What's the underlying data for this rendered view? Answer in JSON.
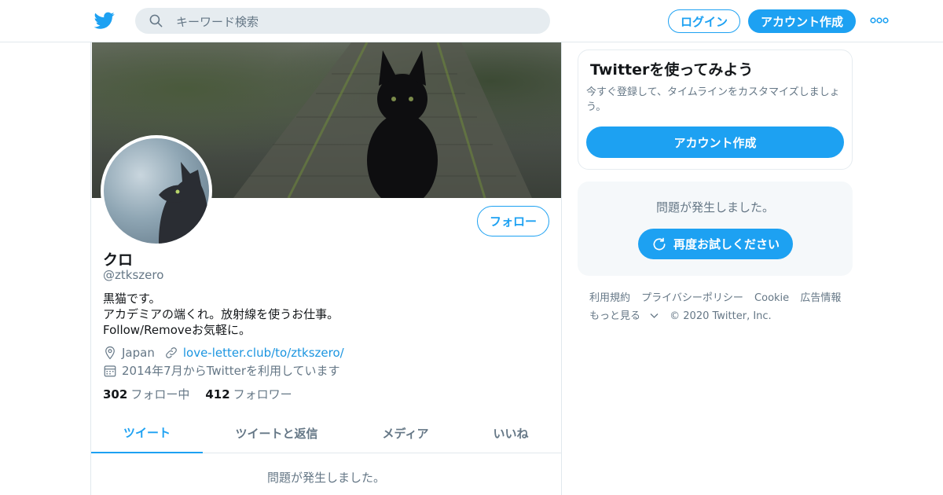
{
  "header": {
    "search_placeholder": "キーワード検索",
    "login_label": "ログイン",
    "signup_label": "アカウント作成",
    "more_icon": "ellipsis-icon",
    "brand_color": "#1da1f2"
  },
  "profile": {
    "name": "クロ",
    "handle": "@ztkszero",
    "follow_label": "フォロー",
    "bio": [
      "黒猫です。",
      "アカデミアの端くれ。放射線を使うお仕事。",
      "Follow/Removeお気軽に。"
    ],
    "location": "Japan",
    "website": "love-letter.club/to/ztkszero/",
    "joined": "2014年7月からTwitterを利用しています",
    "following_count": "302",
    "following_label": "フォロー中",
    "followers_count": "412",
    "followers_label": "フォロワー"
  },
  "tabs": [
    {
      "label": "ツイート",
      "active": true
    },
    {
      "label": "ツイートと返信",
      "active": false
    },
    {
      "label": "メディア",
      "active": false
    },
    {
      "label": "いいね",
      "active": false
    }
  ],
  "timeline": {
    "error_message": "問題が発生しました。"
  },
  "sidebar": {
    "signup_title": "Twitterを使ってみよう",
    "signup_desc": "今すぐ登録して、タイムラインをカスタマイズしましょう。",
    "signup_button": "アカウント作成",
    "error_message": "問題が発生しました。",
    "retry_button": "再度お試しください"
  },
  "footer": {
    "links": [
      "利用規約",
      "プライバシーポリシー",
      "Cookie",
      "広告情報",
      "もっと見る"
    ],
    "copyright": "© 2020 Twitter, Inc."
  }
}
